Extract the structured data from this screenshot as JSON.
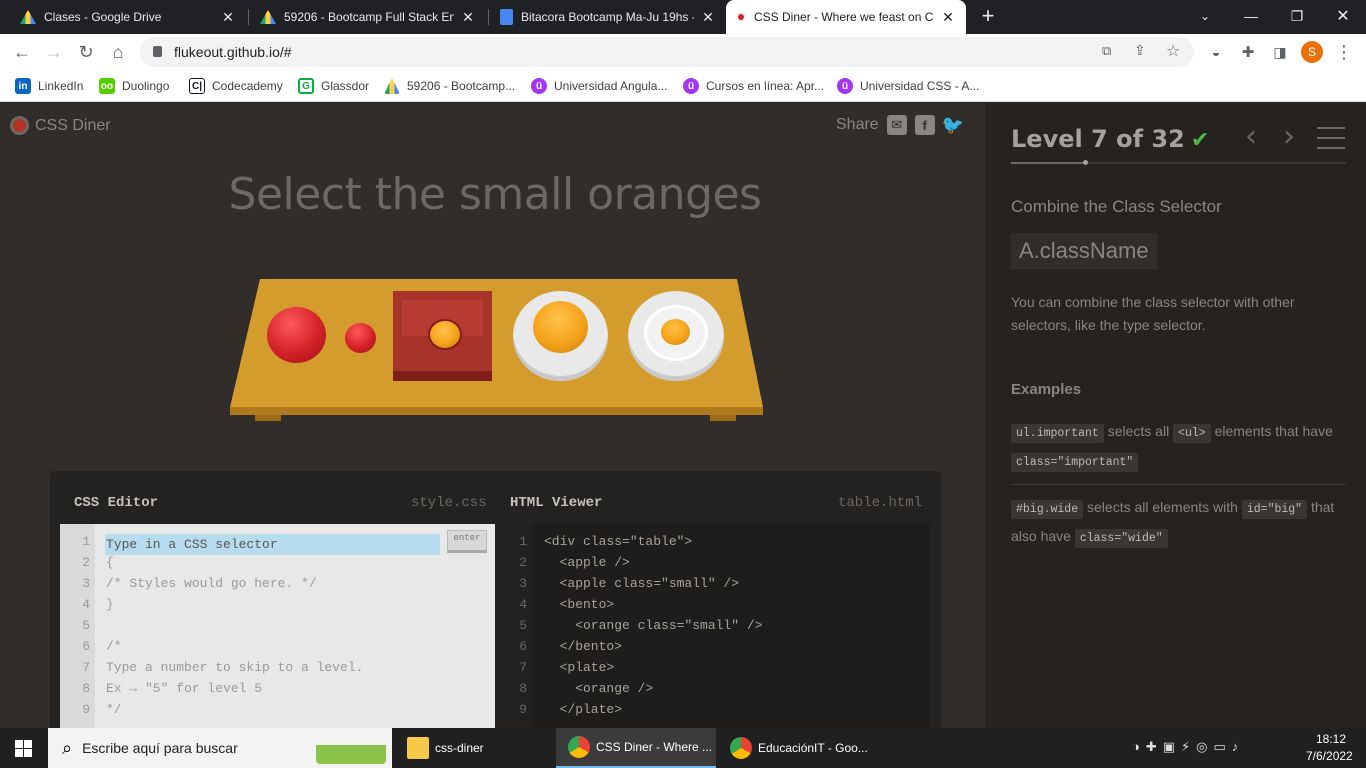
{
  "browser": {
    "tabs": [
      {
        "title": "Clases - Google Drive",
        "close": "✕"
      },
      {
        "title": "59206 - Bootcamp Full Stack Eng",
        "close": "✕"
      },
      {
        "title": "Bitacora Bootcamp Ma-Ju 19hs -",
        "close": "✕"
      },
      {
        "title": "CSS Diner - Where we feast on C",
        "close": "✕"
      }
    ],
    "new_tab": "+",
    "url": "flukeout.github.io/#",
    "profile_initial": "S",
    "bookmarks": [
      {
        "label": "LinkedIn",
        "icon": "in"
      },
      {
        "label": "Duolingo",
        "icon": "oo"
      },
      {
        "label": "Codecademy",
        "icon": "C|"
      },
      {
        "label": "Glassdor",
        "icon": "G"
      },
      {
        "label": "59206 - Bootcamp...",
        "icon": "drive"
      },
      {
        "label": "Universidad Angula...",
        "icon": "ü"
      },
      {
        "label": "Cursos en línea: Apr...",
        "icon": "ü"
      },
      {
        "label": "Universidad CSS - A...",
        "icon": "ü"
      }
    ]
  },
  "app": {
    "logo": "CSS Diner",
    "share": "Share",
    "instruction": "Select the small oranges"
  },
  "editor": {
    "css_title": "CSS Editor",
    "css_file": "style.css",
    "html_title": "HTML Viewer",
    "html_file": "table.html",
    "input_placeholder": "Type in a CSS selector",
    "enter": "enter",
    "css_lines": [
      "{",
      "/* Styles would go here. */",
      "}",
      "",
      "/*",
      "Type a number to skip to a level.",
      "Ex → \"5\" for level 5",
      "*/"
    ],
    "line_numbers": [
      "1",
      "2",
      "3",
      "4",
      "5",
      "6",
      "7",
      "8",
      "9"
    ],
    "html_lines": [
      "<div class=\"table\">",
      "  <apple />",
      "  <apple class=\"small\" />",
      "  <bento>",
      "    <orange class=\"small\" />",
      "  </bento>",
      "  <plate>",
      "    <orange />",
      "  </plate>"
    ]
  },
  "sidebar": {
    "level": "Level 7 of 32",
    "check": "✔",
    "level_progress": 0.22,
    "selector_name": "Combine the Class Selector",
    "syntax": "A.className",
    "hint": "You can combine the class selector with other selectors, like the type selector.",
    "examples_title": "Examples",
    "ex1": {
      "code1": "ul.important",
      "t1": " selects all ",
      "code2": "<ul>",
      "t2": " elements that have ",
      "code3": "class=\"important\""
    },
    "ex2": {
      "code1": "#big.wide",
      "t1": " selects all elements with ",
      "code2": "id=\"big\"",
      "t2": " that also have ",
      "code3": "class=\"wide\""
    }
  },
  "taskbar": {
    "search_placeholder": "Escribe aquí para buscar",
    "apps": [
      {
        "label": "css-diner"
      },
      {
        "label": "CSS Diner - Where ..."
      },
      {
        "label": "EducaciónIT - Goo..."
      }
    ],
    "time": "18:12",
    "date": "7/6/2022"
  },
  "colors": {
    "accent_check": "#4cbb47",
    "apple": "#d32128",
    "orange": "#f5a31c",
    "table": "#d49b2d",
    "bento": "#a8332b"
  }
}
